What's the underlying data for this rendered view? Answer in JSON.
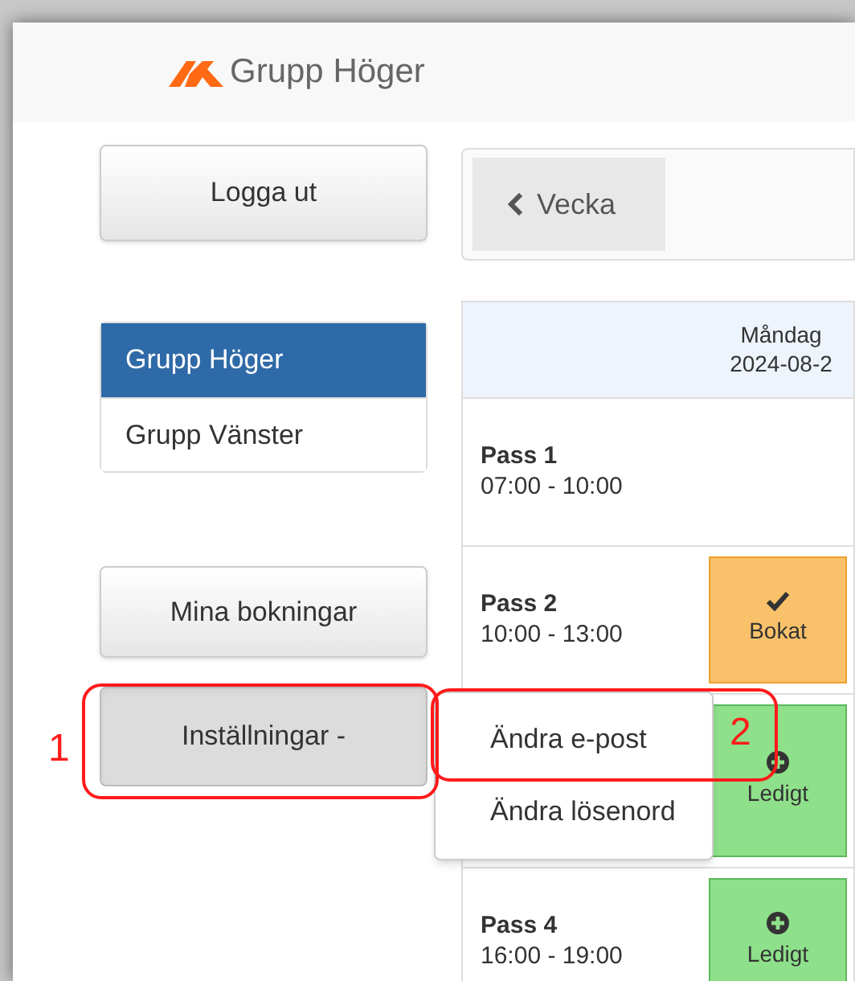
{
  "brand": {
    "name": "Grupp Höger"
  },
  "logout_button": "Logga ut",
  "week_nav": {
    "prev_label": "Vecka"
  },
  "groups": [
    {
      "label": "Grupp Höger",
      "selected": true
    },
    {
      "label": "Grupp Vänster",
      "selected": false
    }
  ],
  "my_bookings_button": "Mina bokningar",
  "settings_button": {
    "label": "Inställningar",
    "caret": "-",
    "expanded": true
  },
  "settings_menu": [
    {
      "label": "Ändra e-post",
      "annotation": "2"
    },
    {
      "label": "Ändra lösenord"
    }
  ],
  "settings_annotation": "1",
  "schedule": {
    "day": {
      "name": "Måndag",
      "date": "2024-08-2"
    },
    "rows": [
      {
        "label": "Pass 1",
        "time": "07:00 - 10:00",
        "kind": "none"
      },
      {
        "label": "Pass 2",
        "time": "10:00 - 13:00",
        "kind": "booked",
        "status": "Bokat"
      },
      {
        "kind": "free",
        "status": "Ledigt"
      },
      {
        "label": "Pass 4",
        "time": "16:00 - 19:00",
        "kind": "free",
        "status": "Ledigt"
      }
    ]
  }
}
